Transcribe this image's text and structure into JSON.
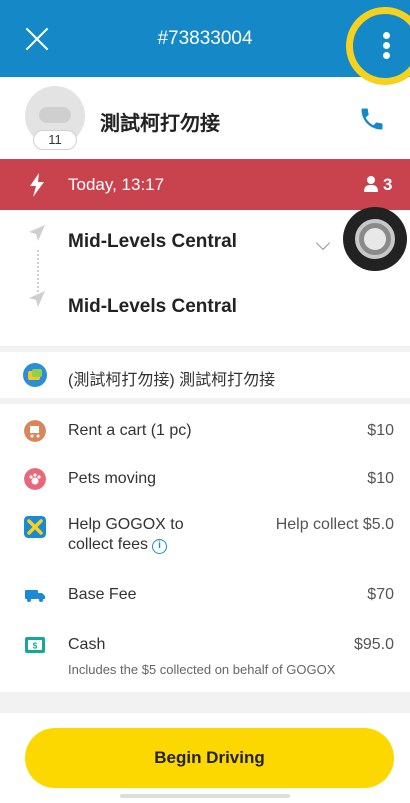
{
  "header": {
    "order_id": "#73833004"
  },
  "customer": {
    "badge_count": "11",
    "name": "測試柯打勿接"
  },
  "trip": {
    "time": "Today, 13:17",
    "passengers": "3"
  },
  "route": {
    "pickup": "Mid-Levels Central",
    "dropoff": "Mid-Levels Central"
  },
  "remark": {
    "text": "(測試柯打勿接) 測試柯打勿接"
  },
  "fees": {
    "cart": {
      "label": "Rent a cart (1 pc)",
      "value": "$10"
    },
    "pets": {
      "label": "Pets moving",
      "value": "$10"
    },
    "collect": {
      "label_line1": "Help GOGOX to",
      "label_line2": "collect fees",
      "value": "Help collect $5.0"
    },
    "base": {
      "label": "Base Fee",
      "value": "$70"
    },
    "cash": {
      "label": "Cash",
      "value": "$95.0",
      "note": "Includes the $5 collected on behalf of GOGOX"
    }
  },
  "actions": {
    "begin_label": "Begin Driving"
  },
  "colors": {
    "header": "#1588c7",
    "time_bar": "#c9434f",
    "primary_button": "#fdd700",
    "highlight_ring": "#f6d21e"
  },
  "icons": [
    "close-icon",
    "more-vertical-icon",
    "phone-icon",
    "lightning-icon",
    "person-icon",
    "navigation-arrow-icon",
    "chat-icon",
    "cart-icon",
    "paw-icon",
    "gogox-icon",
    "truck-icon",
    "cash-icon",
    "info-icon"
  ]
}
